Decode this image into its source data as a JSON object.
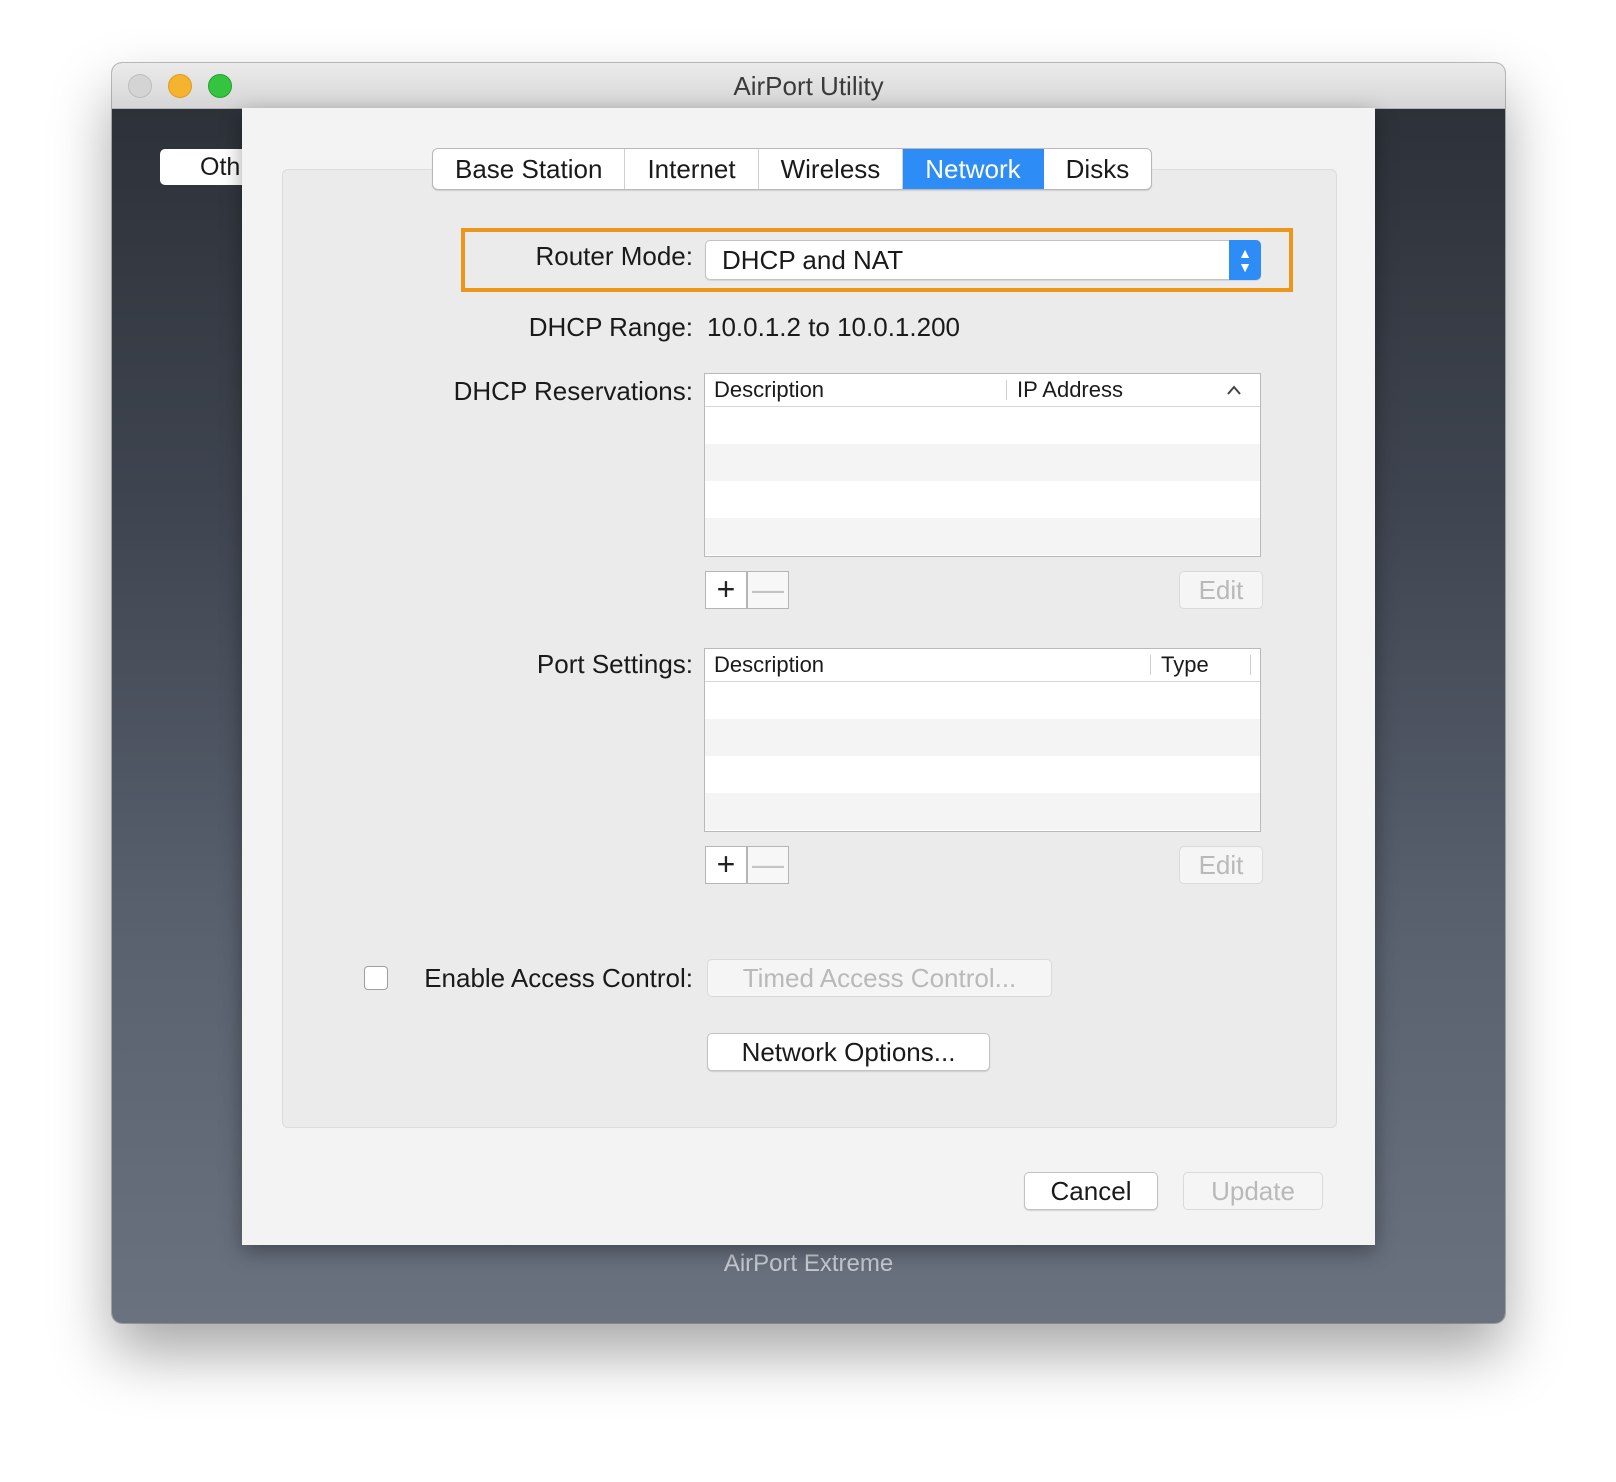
{
  "window": {
    "title": "AirPort Utility",
    "sidebar_button": "Oth",
    "device_label": "AirPort Extreme"
  },
  "tabs": [
    {
      "label": "Base Station",
      "active": false
    },
    {
      "label": "Internet",
      "active": false
    },
    {
      "label": "Wireless",
      "active": false
    },
    {
      "label": "Network",
      "active": true
    },
    {
      "label": "Disks",
      "active": false
    }
  ],
  "router_mode": {
    "label": "Router Mode:",
    "value": "DHCP and NAT",
    "highlight_color": "#ec961b"
  },
  "dhcp_range": {
    "label": "DHCP Range:",
    "value": "10.0.1.2 to 10.0.1.200"
  },
  "dhcp_reservations": {
    "label": "DHCP Reservations:",
    "columns": [
      "Description",
      "IP Address"
    ],
    "sort_icon": "chevron-up-icon",
    "add_icon": "+",
    "remove_icon": "—",
    "edit_label": "Edit"
  },
  "port_settings": {
    "label": "Port Settings:",
    "columns": [
      "Description",
      "Type"
    ],
    "add_icon": "+",
    "remove_icon": "—",
    "edit_label": "Edit"
  },
  "access_control": {
    "label": "Enable Access Control:",
    "checked": false,
    "timed_button": "Timed Access Control..."
  },
  "network_options_button": "Network Options...",
  "footer": {
    "cancel": "Cancel",
    "update": "Update"
  },
  "colors": {
    "accent": "#2e8cf6",
    "highlight": "#ec961b"
  }
}
